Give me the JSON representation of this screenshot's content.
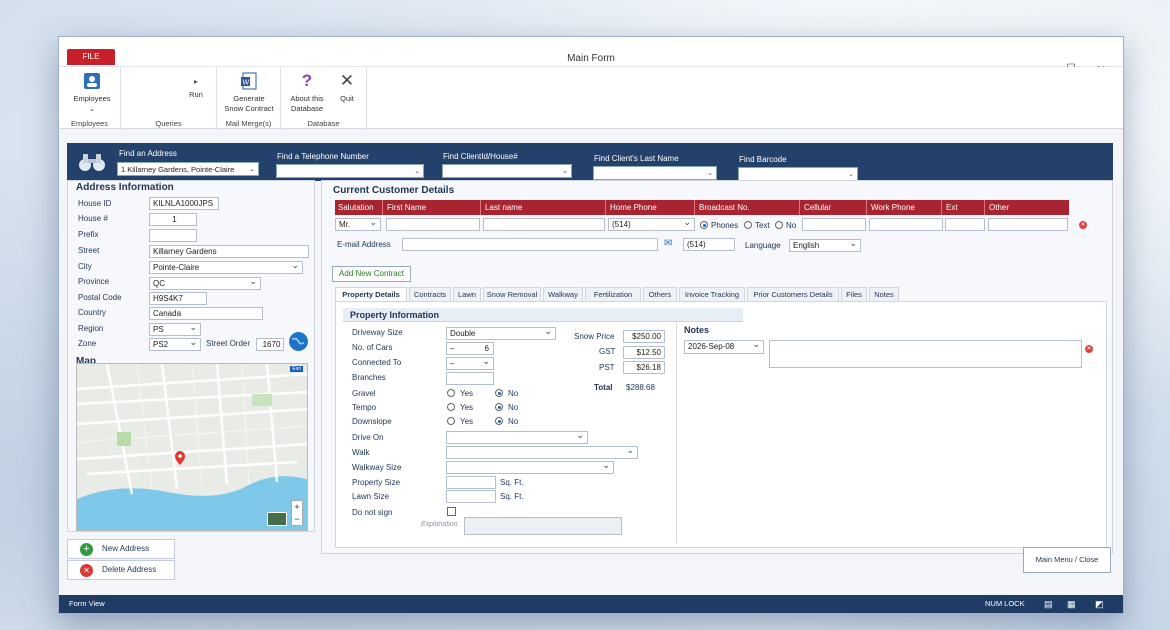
{
  "window": {
    "title": "Main Form",
    "file_tab": "FILE",
    "home_tab": "",
    "controls": {
      "minimize": "—",
      "maximize": "☐",
      "close": "✕"
    }
  },
  "ribbon": {
    "employees": {
      "label": "Employees",
      "group": "Employees",
      "icon": "employees-icon"
    },
    "queries": {
      "run": "Run",
      "group": "Queries",
      "icon": "run-arrow-icon"
    },
    "mail": {
      "label": "Generate Snow Contract",
      "line1": "Generate",
      "line2": "Snow Contract",
      "group": "Mail Merge(s)",
      "icon": "word-doc-icon"
    },
    "database": {
      "about1": "About this",
      "about2": "Database",
      "quit": "Quit",
      "group": "Database"
    }
  },
  "find": {
    "address_label": "Find an Address",
    "address_value": "1 Killarney Gardens, Pointe-Claire",
    "phone_label": "Find a Telephone Number",
    "client_label": "Find ClientId/House#",
    "lastname_label": "Find Client's Last Name",
    "barcode_label": "Find Barcode"
  },
  "address": {
    "title": "Address Information",
    "fields": [
      {
        "label": "House ID",
        "value": "KILNLA1000JPS"
      },
      {
        "label": "House #",
        "value": "1"
      },
      {
        "label": "Prefix",
        "value": ""
      },
      {
        "label": "Street",
        "value": "Killarney Gardens"
      },
      {
        "label": "City",
        "value": "Pointe-Claire"
      },
      {
        "label": "Province",
        "value": "QC"
      },
      {
        "label": "Postal Code",
        "value": "H9S4K7"
      },
      {
        "label": "Country",
        "value": "Canada"
      },
      {
        "label": "Region",
        "value": "PS"
      },
      {
        "label": "Zone",
        "value": "PS2"
      }
    ],
    "street_order_label": "Street Order",
    "street_order": "1670"
  },
  "map": {
    "title": "Map",
    "badge": "Esri",
    "zoom_in": "+",
    "zoom_out": "−"
  },
  "sidebar_buttons": {
    "new_address": "New Address",
    "delete_address": "Delete Address"
  },
  "customer": {
    "title": "Current Customer Details",
    "headers": [
      "Salutation",
      "First Name",
      "Last name",
      "Home Phone",
      "Broadcast No.",
      "Cellular",
      "Work Phone",
      "Ext",
      "Other"
    ],
    "salutation": "Mr.",
    "home_phone": "(514)",
    "broadcast_options": [
      "Phones",
      "Text",
      "No"
    ],
    "email_label": "E-mail Address",
    "email_phone": "(514)",
    "language_label": "Language",
    "language": "English",
    "add_contract": "Add New Contract"
  },
  "tabs": [
    "Property Details",
    "Contracts",
    "Lawn",
    "Snow Removal",
    "Walkway",
    "Fertilization",
    "Others",
    "Invoice Tracking",
    "Prior Customers Details",
    "Files",
    "Notes"
  ],
  "property": {
    "title": "Property Information",
    "driveway_size_label": "Driveway Size",
    "driveway_size": "Double",
    "cars_label": "No. of Cars",
    "cars": "6",
    "cars_prefix": "–",
    "connected_label": "Connected To",
    "connected": "–",
    "branches_label": "Branches",
    "gravel_label": "Gravel",
    "tempo_label": "Tempo",
    "downslope_label": "Downslope",
    "yes": "Yes",
    "no": "No",
    "drive_on_label": "Drive On",
    "walk_label": "Walk",
    "walkway_size_label": "Walkway Size",
    "property_size_label": "Property Size",
    "lawn_size_label": "Lawn Size",
    "sqft": "Sq. Ft.",
    "do_not_sign_label": "Do not sign",
    "explanation_label": "Explanation"
  },
  "pricing": {
    "snow_price_label": "Snow Price",
    "snow_price": "$250.00",
    "gst_label": "GST",
    "gst": "$12.50",
    "pst_label": "PST",
    "pst": "$26.18",
    "total_label": "Total",
    "total": "$288.68"
  },
  "notes": {
    "title": "Notes",
    "date": "2026-Sep-08"
  },
  "main_menu": "Main Menu / Close",
  "status": {
    "left": "Form View",
    "numlock": "NUM LOCK"
  },
  "colors": {
    "accent_red": "#a72430",
    "nav_blue": "#23416a",
    "status_blue": "#1f3c64"
  }
}
